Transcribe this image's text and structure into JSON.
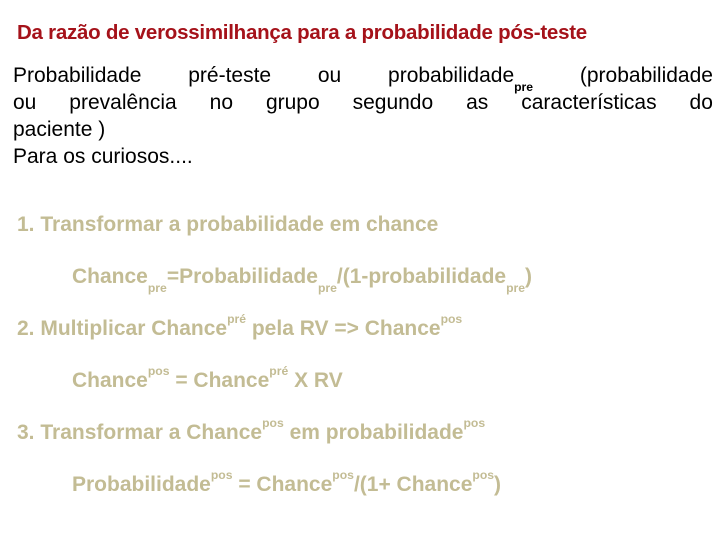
{
  "slide": {
    "title": "Da razão de verossimilhança para a probabilidade pós-teste",
    "background_color": "#ffffff",
    "title_color": "#a5121a",
    "body_color": "#000000",
    "accent_color": "#c3bc94"
  },
  "body": {
    "line1_a": "Probabilidade",
    "line1_b": "pré-teste",
    "line1_c": "ou",
    "line1_d": "probabilidade",
    "line1_sub": "pre",
    "line1_e": "(probabilidade",
    "line2_a": "ou",
    "line2_b": "prevalência",
    "line2_c": "no",
    "line2_d": "grupo",
    "line2_e": "segundo",
    "line2_f": "as",
    "line2_g": "características",
    "line2_h": "do",
    "line3": "paciente )",
    "line4": "Para os curiosos...."
  },
  "steps": [
    {
      "kind": "heading",
      "number": "1.",
      "text": "Transformar a probabilidade em chance"
    },
    {
      "kind": "formula",
      "p1": "Chance",
      "s1": "pre",
      "p2": "=Probabilidade",
      "s2": "pre",
      "p3": "/(1-probabilidade",
      "s3": "pre",
      "p4": ")"
    },
    {
      "kind": "heading",
      "number": "2.",
      "p1": "Multiplicar Chance",
      "s1": "pré",
      "p2": " pela RV => Chance",
      "s2": "pos"
    },
    {
      "kind": "formula",
      "p1": "Chance",
      "s1": "pos",
      "p2": " = Chance",
      "s2": "pré",
      "p3": " X RV"
    },
    {
      "kind": "heading",
      "number": "3.",
      "p1": "Transformar a Chance",
      "s1": "pos",
      "p2": " em probabilidade",
      "s2": "pos"
    },
    {
      "kind": "formula",
      "p1": "Probabilidade",
      "s1": "pos",
      "p2": " = Chance",
      "s2": "pos",
      "p3": "/(1+ Chance",
      "s3": "pos",
      "p4": ")"
    }
  ]
}
